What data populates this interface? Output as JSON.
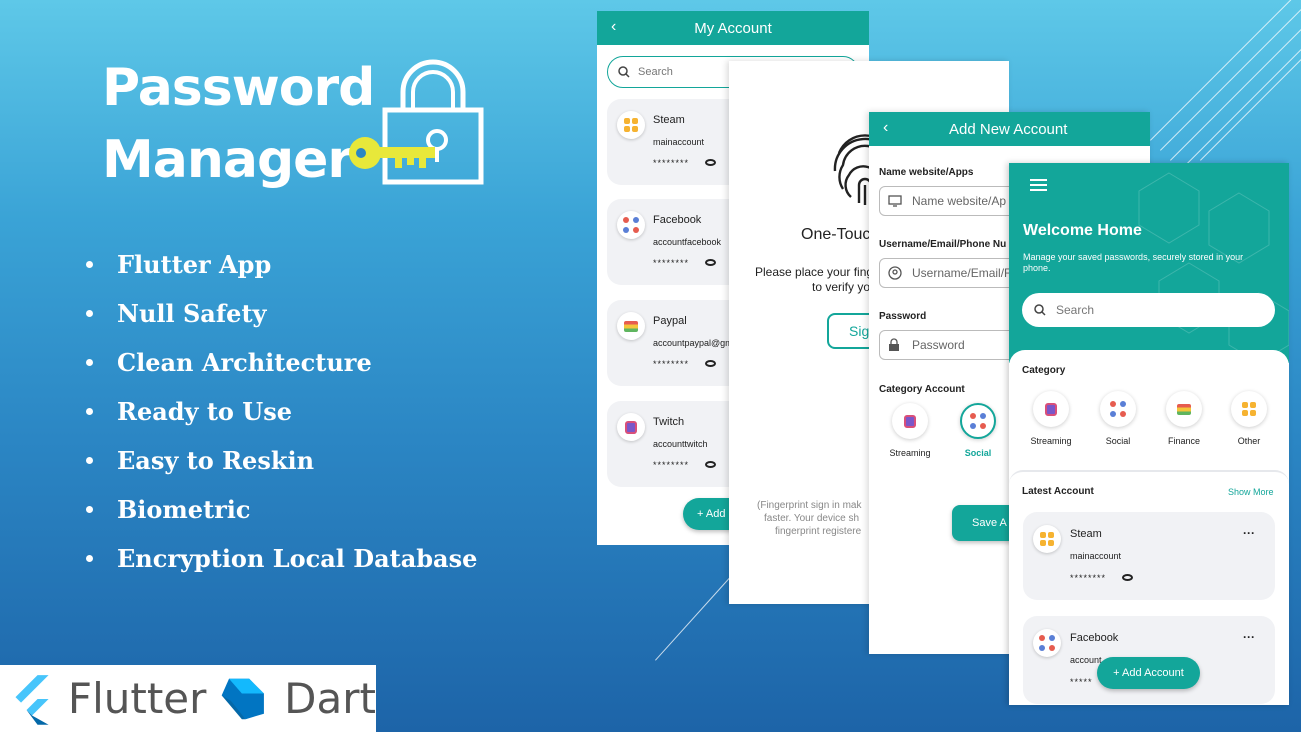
{
  "title_line1": "Password",
  "title_line2": "Manager",
  "features": [
    "Flutter App",
    "Null Safety",
    "Clean Architecture",
    "Ready to Use",
    "Easy to Reskin",
    "Biometric",
    "Encryption Local Database"
  ],
  "logos": {
    "flutter": "Flutter",
    "dart": "Dart"
  },
  "screen_my_account": {
    "title": "My Account",
    "search_placeholder": "Search",
    "accounts": [
      {
        "name": "Steam",
        "user": "mainaccount",
        "password": "********"
      },
      {
        "name": "Facebook",
        "user": "accountfacebook",
        "password": "********"
      },
      {
        "name": "Paypal",
        "user": "accountpaypal@gm",
        "password": "********"
      },
      {
        "name": "Twitch",
        "user": "accounttwitch",
        "password": "********"
      }
    ],
    "add_label": "+ Add"
  },
  "screen_biometric": {
    "title": "One-Touc",
    "instruction_1": "Please place your fing",
    "instruction_2": "to verify yo",
    "button": "Sign",
    "note_1": "(Fingerprint sign in mak",
    "note_2": "faster. Your device sh",
    "note_3": "fingerprint registere"
  },
  "screen_add_account": {
    "title": "Add New Account",
    "website_label": "Name website/Apps",
    "website_placeholder": "Name website/Ap",
    "username_label": "Username/Email/Phone Nu",
    "username_placeholder": "Username/Email/F",
    "password_label": "Password",
    "password_placeholder": "Password",
    "category_label": "Category Account",
    "categories": [
      "Streaming",
      "Social"
    ],
    "selected_category": "Social",
    "save_label": "Save A"
  },
  "screen_home": {
    "welcome": "Welcome Home",
    "subtitle_1": "Manage your saved passwords, securely stored in your",
    "subtitle_2": "phone.",
    "search_placeholder": "Search",
    "category_title": "Category",
    "categories": [
      "Streaming",
      "Social",
      "Finance",
      "Other"
    ],
    "latest_title": "Latest Account",
    "show_more": "Show More",
    "accounts": [
      {
        "name": "Steam",
        "user": "mainaccount",
        "password": "********",
        "menu": "···"
      },
      {
        "name": "Facebook",
        "user": "account",
        "password": "*****",
        "menu": "···"
      }
    ],
    "add_account": "+ Add Account"
  },
  "colors": {
    "teal": "#13a69a",
    "background_top": "#5ec8e8",
    "background_bottom": "#1d64a8",
    "key": "#e8e83a"
  }
}
